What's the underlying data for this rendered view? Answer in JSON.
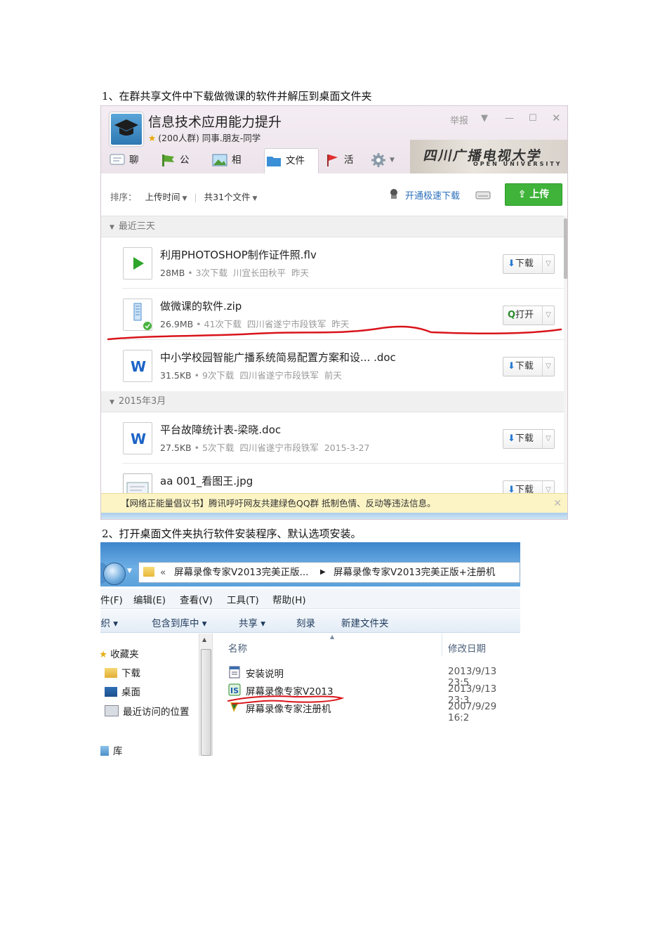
{
  "step1": "1、在群共享文件中下载做微课的软件并解压到桌面文件夹",
  "step2": "2、打开桌面文件夹执行软件安装程序、默认选项安装。",
  "qq": {
    "group_name": "信息技术应用能力提升",
    "group_info": "(200人群) 同事.朋友-同学",
    "report": "举报",
    "tabs": [
      "聊天",
      "公告",
      "相册",
      "文件",
      "活动"
    ],
    "banner_text": "四川广播电视大学",
    "banner_text2": "OPEN UNIVERSITY",
    "sort_label": "排序：",
    "sort_value": "上传时间",
    "file_count": "共31个文件",
    "speed_download": "开通极速下载",
    "upload_label": "上传",
    "section_recent": "最近三天",
    "section_march": "2015年3月",
    "files": [
      {
        "name": "利用PHOTOSHOP制作证件照.flv",
        "size": "28MB",
        "downloads": "3次下载",
        "uploader": "川宜长田秋平",
        "date": "昨天",
        "action": "下载",
        "icon": "play-icon"
      },
      {
        "name": "做微课的软件.zip",
        "size": "26.9MB",
        "downloads": "41次下载",
        "uploader": "四川省遂宁市段铁军",
        "date": "昨天",
        "action": "打开",
        "icon": "zip-icon"
      },
      {
        "name": "中小学校园智能广播系统简易配置方案和设... .doc",
        "size": "31.5KB",
        "downloads": "9次下载",
        "uploader": "四川省遂宁市段铁军",
        "date": "前天",
        "action": "下载",
        "icon": "word-icon"
      },
      {
        "name": "平台故障统计表-梁晓.doc",
        "size": "27.5KB",
        "downloads": "5次下载",
        "uploader": "四川省遂宁市段铁军",
        "date": "2015-3-27",
        "action": "下载",
        "icon": "word-icon"
      },
      {
        "name": "aa 001_看图王.jpg",
        "size": "",
        "downloads": "",
        "uploader": "",
        "date": "",
        "action": "下载",
        "icon": "image-icon"
      }
    ],
    "notice": "【网络正能量倡议书】腾讯呼吁网友共建绿色QQ群 抵制色情、反动等违法信息。"
  },
  "explorer": {
    "breadcrumb1": "屏幕录像专家V2013完美正版...",
    "breadcrumb2": "屏幕录像专家V2013完美正版+注册机",
    "menu": [
      "件(F)",
      "编辑(E)",
      "查看(V)",
      "工具(T)",
      "帮助(H)"
    ],
    "commands": [
      "组织 ▾",
      "包含到库中 ▾",
      "共享 ▾",
      "刻录",
      "新建文件夹"
    ],
    "nav": [
      "收藏夹",
      "下载",
      "桌面",
      "最近访问的位置",
      "库"
    ],
    "col_name": "名称",
    "col_date": "修改日期",
    "rows": [
      {
        "name": "安装说明",
        "date": "2013/9/13 23:5"
      },
      {
        "name": "屏幕录像专家V2013",
        "date": "2013/9/13 23:3"
      },
      {
        "name": "屏幕录像专家注册机",
        "date": "2007/9/29 16:2"
      }
    ]
  },
  "colors": {
    "upload_green": "#3fb33a",
    "annotation_red": "#d9141b",
    "link_blue": "#2a6ebb"
  }
}
